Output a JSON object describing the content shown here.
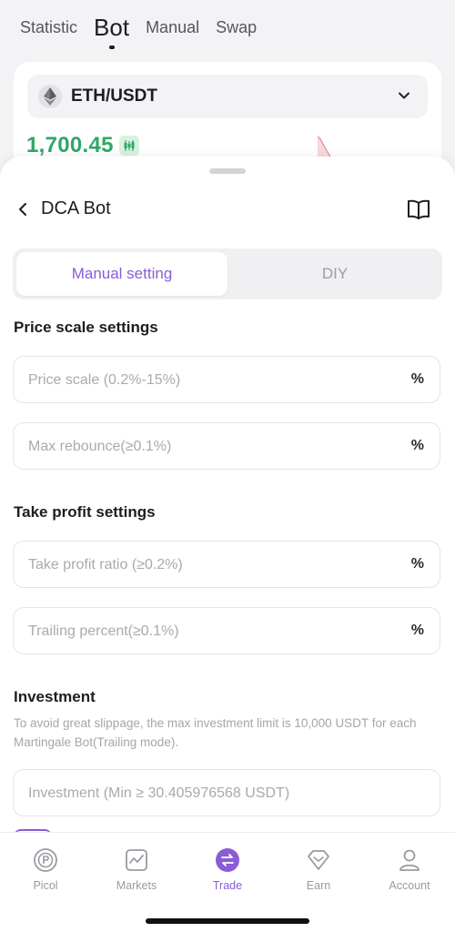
{
  "top_tabs": [
    {
      "label": "Statistic"
    },
    {
      "label": "Bot"
    },
    {
      "label": "Manual"
    },
    {
      "label": "Swap"
    }
  ],
  "market": {
    "pair": "ETH/USDT",
    "price": "1,700.45",
    "price_color": "#2fa766"
  },
  "sheet": {
    "title": "DCA Bot",
    "segments": {
      "active": "Manual setting",
      "inactive": "DIY"
    },
    "price_scale_section": {
      "title": "Price scale settings",
      "price_scale_placeholder": "Price scale (0.2%-15%)",
      "max_rebounce_placeholder": "Max rebounce(≥0.1%)",
      "unit": "%"
    },
    "take_profit_section": {
      "title": "Take profit settings",
      "take_profit_placeholder": "Take profit ratio (≥0.2%)",
      "trailing_placeholder": "Trailing percent(≥0.1%)",
      "unit": "%"
    },
    "investment_section": {
      "title": "Investment",
      "info": "To avoid great slippage, the max investment limit is 10,000 USDT for each Martingale Bot(Trailing mode).",
      "investment_placeholder": "Investment (Min ≥ 30.405976568 USDT)"
    }
  },
  "bottom_nav": [
    {
      "label": "Picol",
      "icon": "picol-icon"
    },
    {
      "label": "Markets",
      "icon": "markets-icon"
    },
    {
      "label": "Trade",
      "icon": "trade-icon",
      "active": true
    },
    {
      "label": "Earn",
      "icon": "earn-icon"
    },
    {
      "label": "Account",
      "icon": "account-icon"
    }
  ],
  "colors": {
    "accent": "#8a5cd6",
    "positive": "#2fa766"
  }
}
